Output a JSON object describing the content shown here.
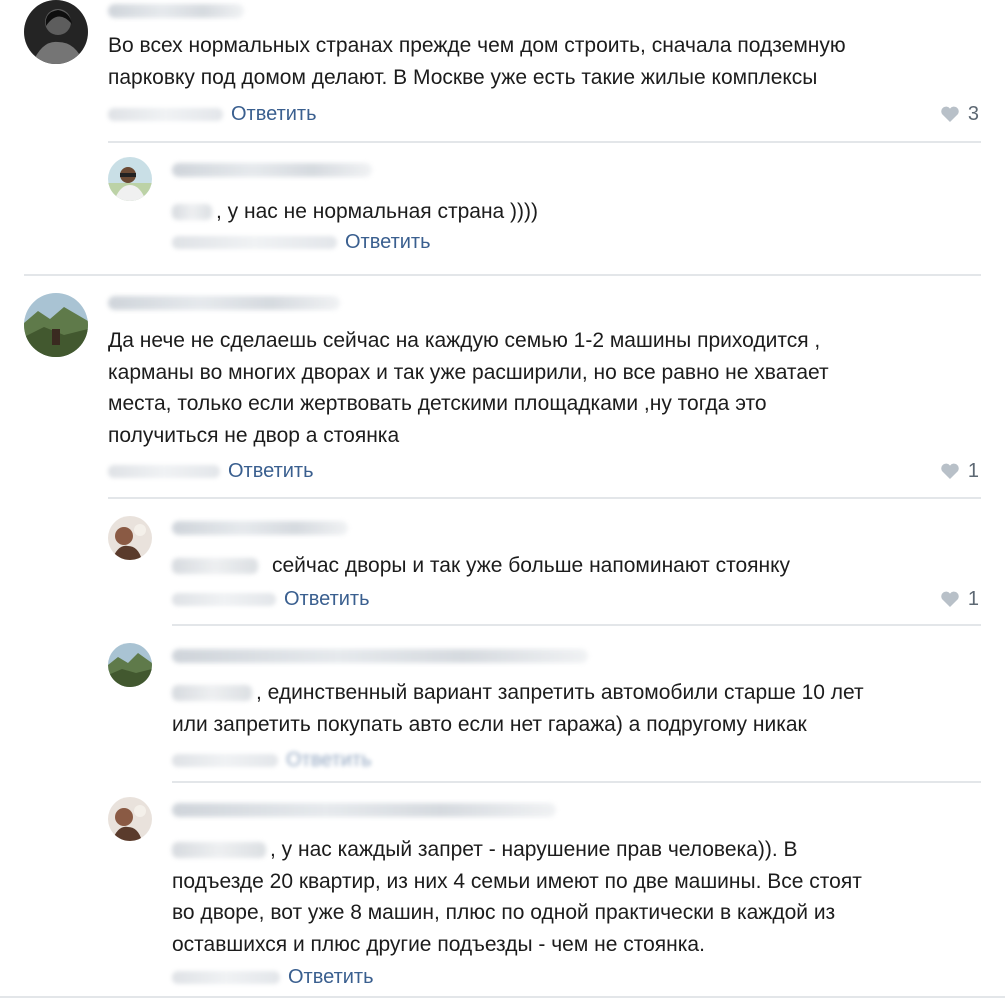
{
  "comments": [
    {
      "text_lines": [
        "Во всех нормальных странах прежде чем дом строить, сначала подземную",
        "парковку под домом делают. В Москве уже есть такие жилые комплексы"
      ],
      "reply_label": "Ответить",
      "likes": "3"
    },
    {
      "text_lines": [
        ", у нас не нормальная страна ))))"
      ],
      "reply_label": "Ответить"
    },
    {
      "text_lines": [
        "Да нече не сделаешь сейчас на каждую семью 1-2 машины приходится ,",
        "карманы во многих дворах и так уже расширили, но все равно не хватает",
        "места, только если жертвовать детскими площадками ,ну тогда это",
        "получиться не двор а стоянка"
      ],
      "reply_label": "Ответить",
      "likes": "1"
    },
    {
      "text_lines": [
        "сейчас дворы и так уже больше напоминают стоянку"
      ],
      "reply_label": "Ответить",
      "likes": "1"
    },
    {
      "text_lines": [
        ", единственный вариант запретить автомобили старше 10 лет",
        "или запретить покупать авто если нет гаража) а подругому никак"
      ],
      "reply_label": "Ответить"
    },
    {
      "text_lines": [
        ", у нас каждый запрет - нарушение прав человека)). В",
        "подъезде 20 квартир, из них 4 семьи имеют по две машины. Все стоят",
        "во дворе, вот уже 8 машин, плюс по одной практически в каждой из",
        "оставшихся и плюс другие подъезды - чем не стоянка."
      ],
      "reply_label": "Ответить"
    }
  ],
  "colors": {
    "link": "#3a5f8f",
    "text": "#1c1c1c",
    "meta": "#5d6873",
    "heart": "#b8c0c8",
    "divider": "#e3e6e9"
  },
  "icons": {
    "like": "heart-icon"
  }
}
